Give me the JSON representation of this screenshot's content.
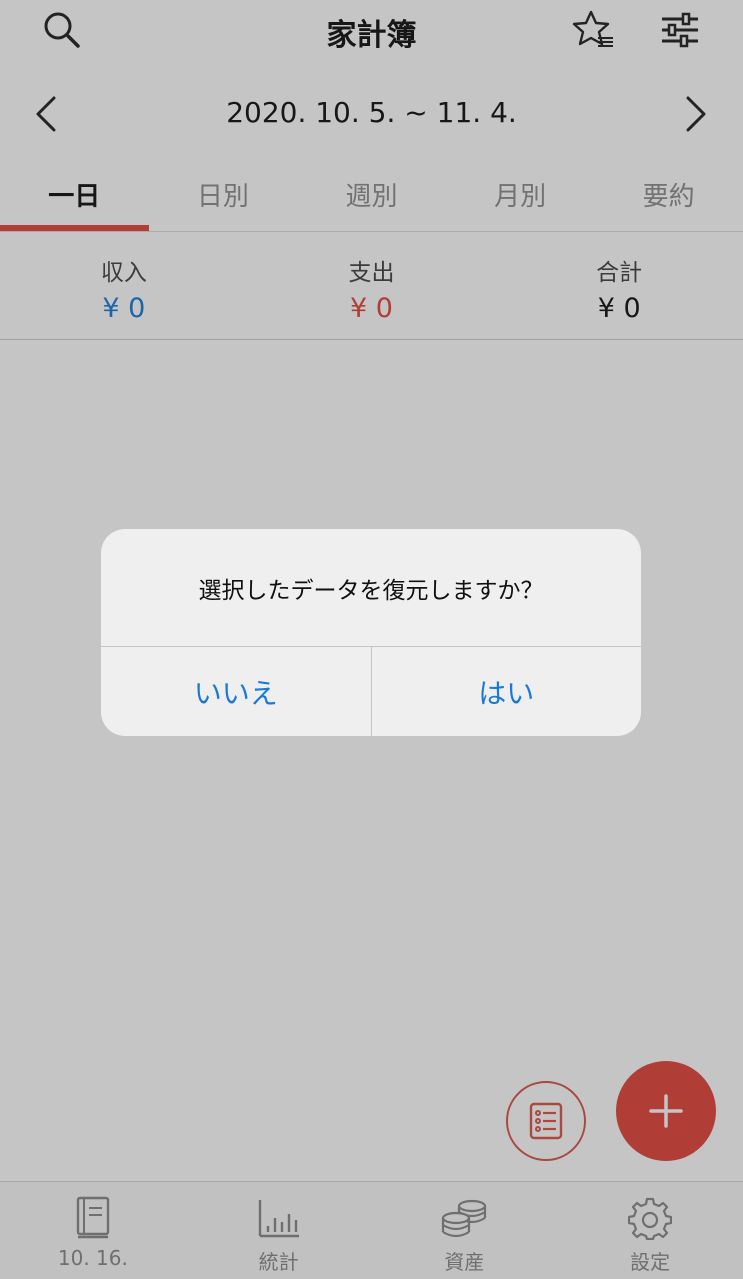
{
  "header": {
    "title": "家計簿"
  },
  "datebar": {
    "range": "2020. 10. 5. ~ 11. 4."
  },
  "tabs": [
    {
      "label": "一日",
      "active": true
    },
    {
      "label": "日別"
    },
    {
      "label": "週別"
    },
    {
      "label": "月別"
    },
    {
      "label": "要約"
    }
  ],
  "summary": {
    "income": {
      "label": "収入",
      "value": "¥ 0",
      "color": "#1a7ad8"
    },
    "expense": {
      "label": "支出",
      "value": "¥ 0",
      "color": "#e2463a"
    },
    "total": {
      "label": "合計",
      "value": "¥ 0",
      "color": "#111111"
    }
  },
  "bottom_nav": [
    {
      "label": "10. 16.",
      "icon": "book-icon"
    },
    {
      "label": "統計",
      "icon": "bar-chart-icon"
    },
    {
      "label": "資産",
      "icon": "coins-icon"
    },
    {
      "label": "設定",
      "icon": "gear-icon"
    }
  ],
  "dialog": {
    "message": "選択したデータを復元しますか？",
    "no_label": "いいえ",
    "yes_label": "はい"
  },
  "colors": {
    "accent": "#e2463a",
    "link": "#1a7ad8"
  }
}
